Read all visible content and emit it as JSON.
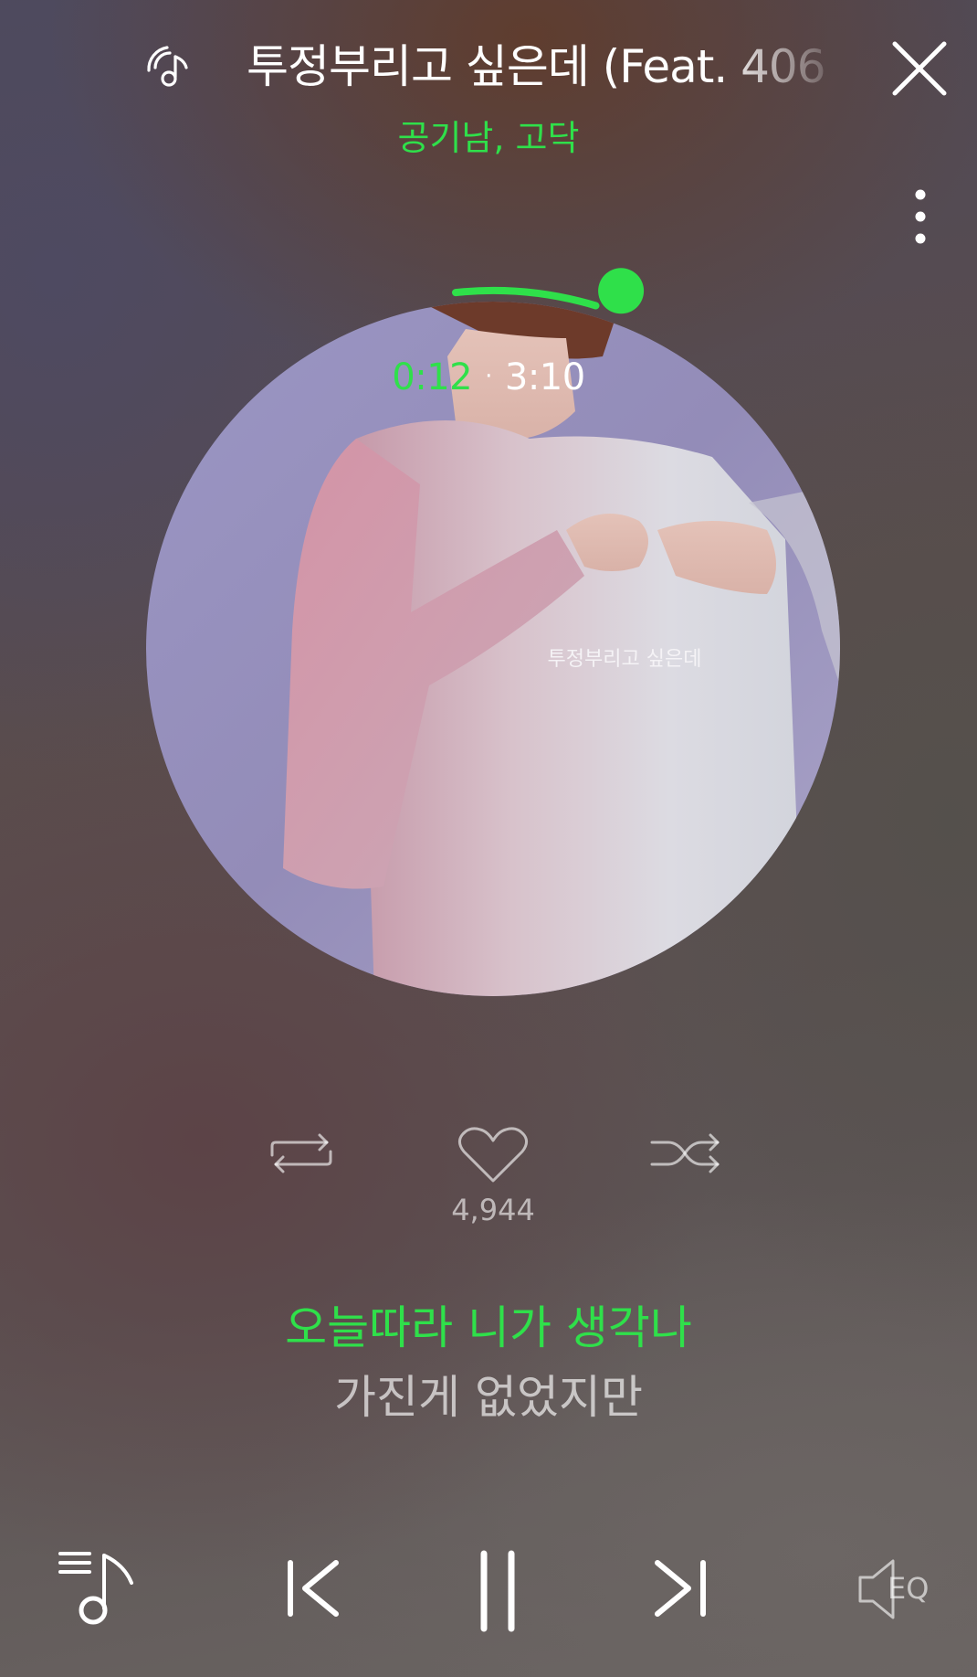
{
  "header": {
    "title": "투정부리고 싶은데 (Feat. 406",
    "artist": "공기남, 고닥",
    "icons": {
      "left": "music-wave-icon",
      "close": "close-icon",
      "more": "more-vertical-icon"
    }
  },
  "album": {
    "cover_text": "투정부리고 싶은데",
    "progress": 0.063
  },
  "playback": {
    "current_time": "0:12",
    "separator": "·",
    "total_time": "3:10"
  },
  "actions": {
    "repeat_icon": "repeat-icon",
    "like_icon": "heart-icon",
    "like_count": "4,944",
    "shuffle_icon": "shuffle-icon"
  },
  "lyrics": {
    "current": "오늘따라 니가 생각나",
    "next": "가진게 없었지만"
  },
  "controls": {
    "playlist_icon": "playlist-icon",
    "previous_icon": "previous-icon",
    "pause_icon": "pause-icon",
    "next_icon": "next-icon",
    "eq_label": "EQ"
  },
  "colors": {
    "accent": "#2fe04a",
    "text": "#ffffff",
    "muted": "#a9a6a6"
  }
}
